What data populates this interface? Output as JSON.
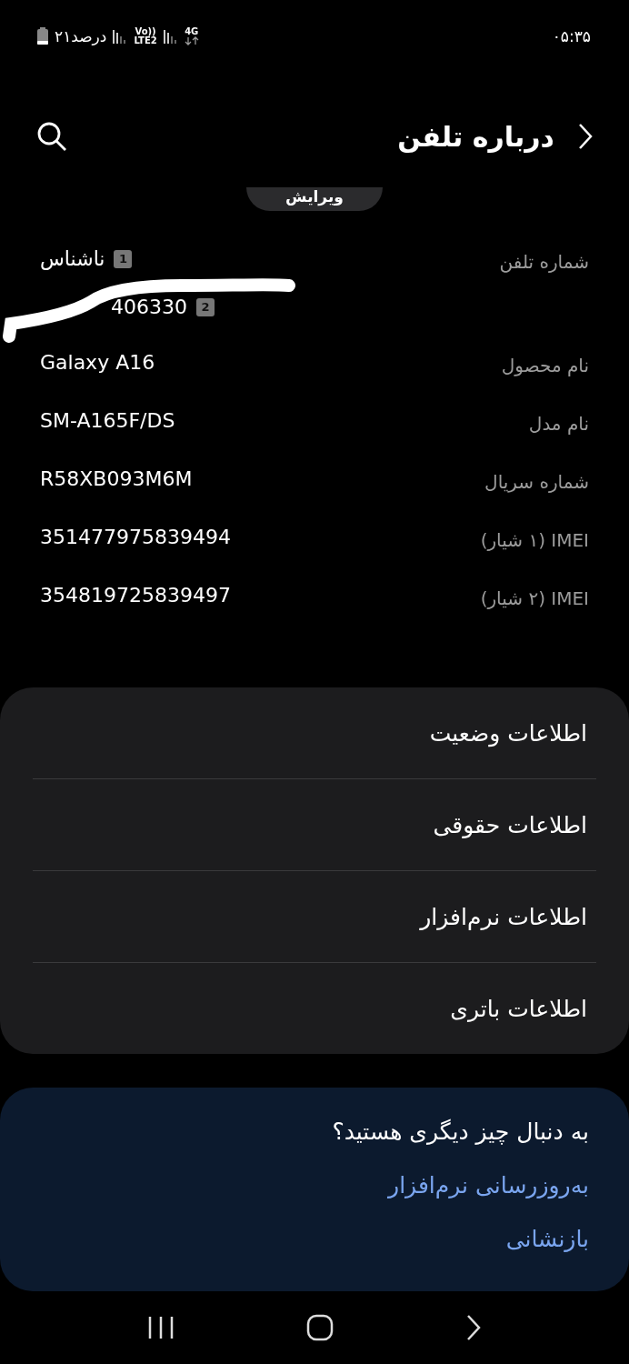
{
  "status_bar": {
    "time": "۰۵:۳۵",
    "battery": "۲۱درصد",
    "volte": "Vo))",
    "lte": "LTE2",
    "network": "4G"
  },
  "header": {
    "title": "درباره تلفن"
  },
  "edit_button": {
    "label": "ویرایش"
  },
  "info_rows": [
    {
      "kind": "phone",
      "label": "شماره تلفن",
      "numbers": [
        {
          "sim": "1",
          "value": "ناشناس"
        },
        {
          "sim": "2",
          "value": "406330"
        }
      ]
    },
    {
      "kind": "text",
      "label": "نام محصول",
      "value": "Galaxy A16"
    },
    {
      "kind": "text",
      "label": "نام مدل",
      "value": "SM-A165F/DS"
    },
    {
      "kind": "text",
      "label": "شماره سریال",
      "value": "R58XB093M6M"
    },
    {
      "kind": "text",
      "label": "IMEI (۱ شیار)",
      "value": "351477975839494"
    },
    {
      "kind": "text",
      "label": "IMEI (۲ شیار)",
      "value": "354819725839497"
    }
  ],
  "menu": [
    "اطلاعات وضعیت",
    "اطلاعات حقوقی",
    "اطلاعات نرم‌افزار",
    "اطلاعات باتری"
  ],
  "suggestions": {
    "title": "به دنبال چیز دیگری هستید؟",
    "links": [
      "به‌روزرسانی نرم‌افزار",
      "بازنشانی"
    ]
  }
}
